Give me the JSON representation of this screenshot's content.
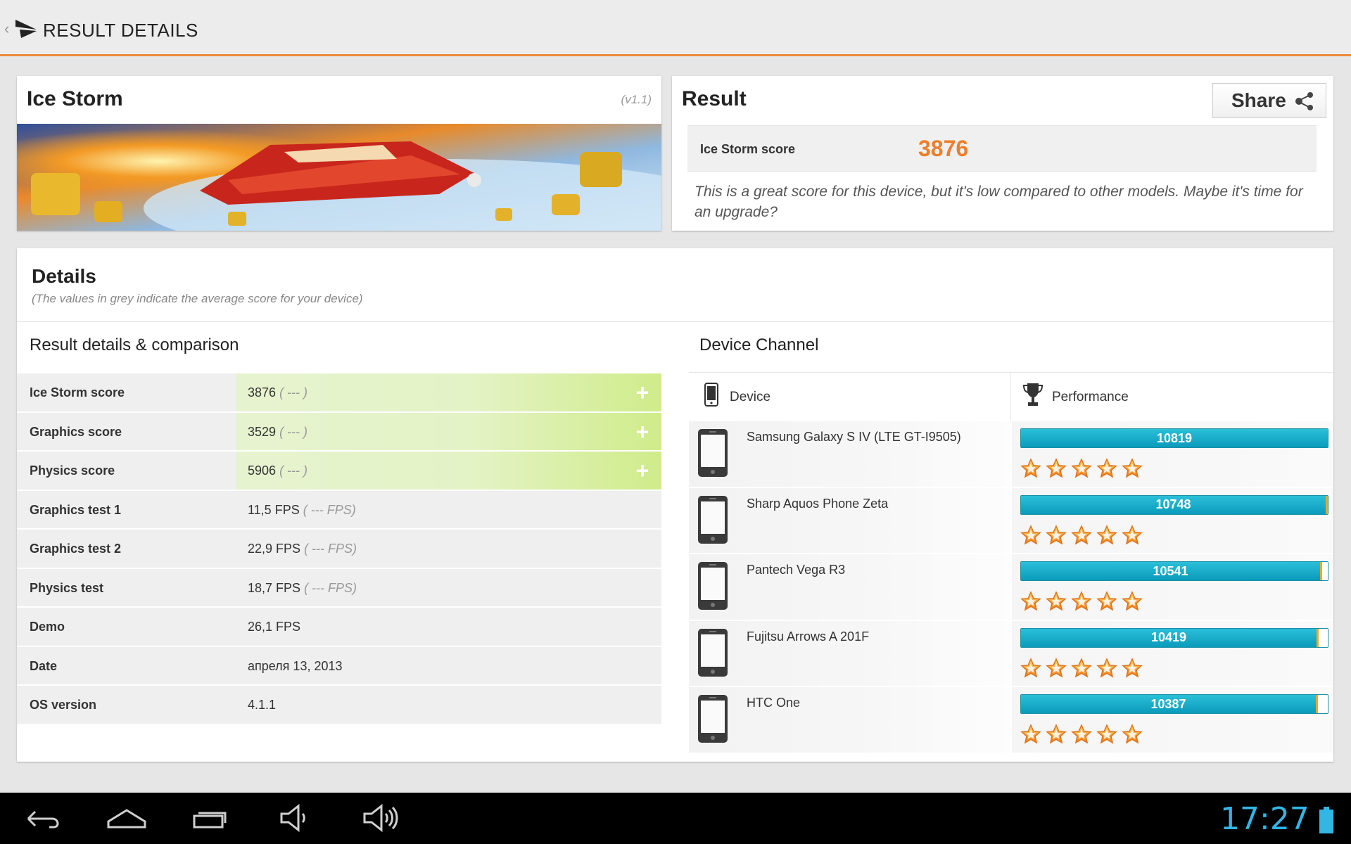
{
  "actionbar": {
    "title": "RESULT DETAILS"
  },
  "test": {
    "name": "Ice Storm",
    "version": "(v1.1)"
  },
  "result": {
    "title": "Result",
    "share_label": "Share",
    "score_label": "Ice Storm score",
    "score_value": "3876",
    "description": "This is a great score for this device, but it's low compared to other models. Maybe it's time for an upgrade?"
  },
  "details": {
    "title": "Details",
    "subtitle": "(The values in grey indicate the average score for your device)",
    "left_title": "Result details & comparison",
    "right_title": "Device Channel",
    "rows": [
      {
        "label": "Ice Storm score",
        "value": "3876",
        "avg": "( --- )",
        "expandable": true
      },
      {
        "label": "Graphics score",
        "value": "3529",
        "avg": "( --- )",
        "expandable": true
      },
      {
        "label": "Physics score",
        "value": "5906",
        "avg": "( --- )",
        "expandable": true
      },
      {
        "label": "Graphics test 1",
        "value": "11,5 FPS",
        "avg": "( --- FPS)",
        "expandable": false
      },
      {
        "label": "Graphics test 2",
        "value": "22,9 FPS",
        "avg": "( --- FPS)",
        "expandable": false
      },
      {
        "label": "Physics test",
        "value": "18,7 FPS",
        "avg": "( --- FPS)",
        "expandable": false
      },
      {
        "label": "Demo",
        "value": "26,1 FPS",
        "avg": "",
        "expandable": false
      },
      {
        "label": "Date",
        "value": "апреля 13, 2013",
        "avg": "",
        "expandable": false
      },
      {
        "label": "OS version",
        "value": "4.1.1",
        "avg": "",
        "expandable": false
      }
    ]
  },
  "channel": {
    "device_header": "Device",
    "performance_header": "Performance",
    "max_score": 10819,
    "devices": [
      {
        "name": "Samsung Galaxy S IV (LTE GT-I9505)",
        "score": 10819,
        "stars": 5
      },
      {
        "name": "Sharp Aquos Phone Zeta",
        "score": 10748,
        "stars": 5
      },
      {
        "name": "Pantech Vega R3",
        "score": 10541,
        "stars": 5
      },
      {
        "name": "Fujitsu Arrows A 201F",
        "score": 10419,
        "stars": 5
      },
      {
        "name": "HTC One",
        "score": 10387,
        "stars": 5
      }
    ]
  },
  "statusbar": {
    "clock": "17:27"
  },
  "colors": {
    "accent": "#ee7e2a",
    "bar": "#0b9bbb",
    "clock": "#33b5e5"
  }
}
